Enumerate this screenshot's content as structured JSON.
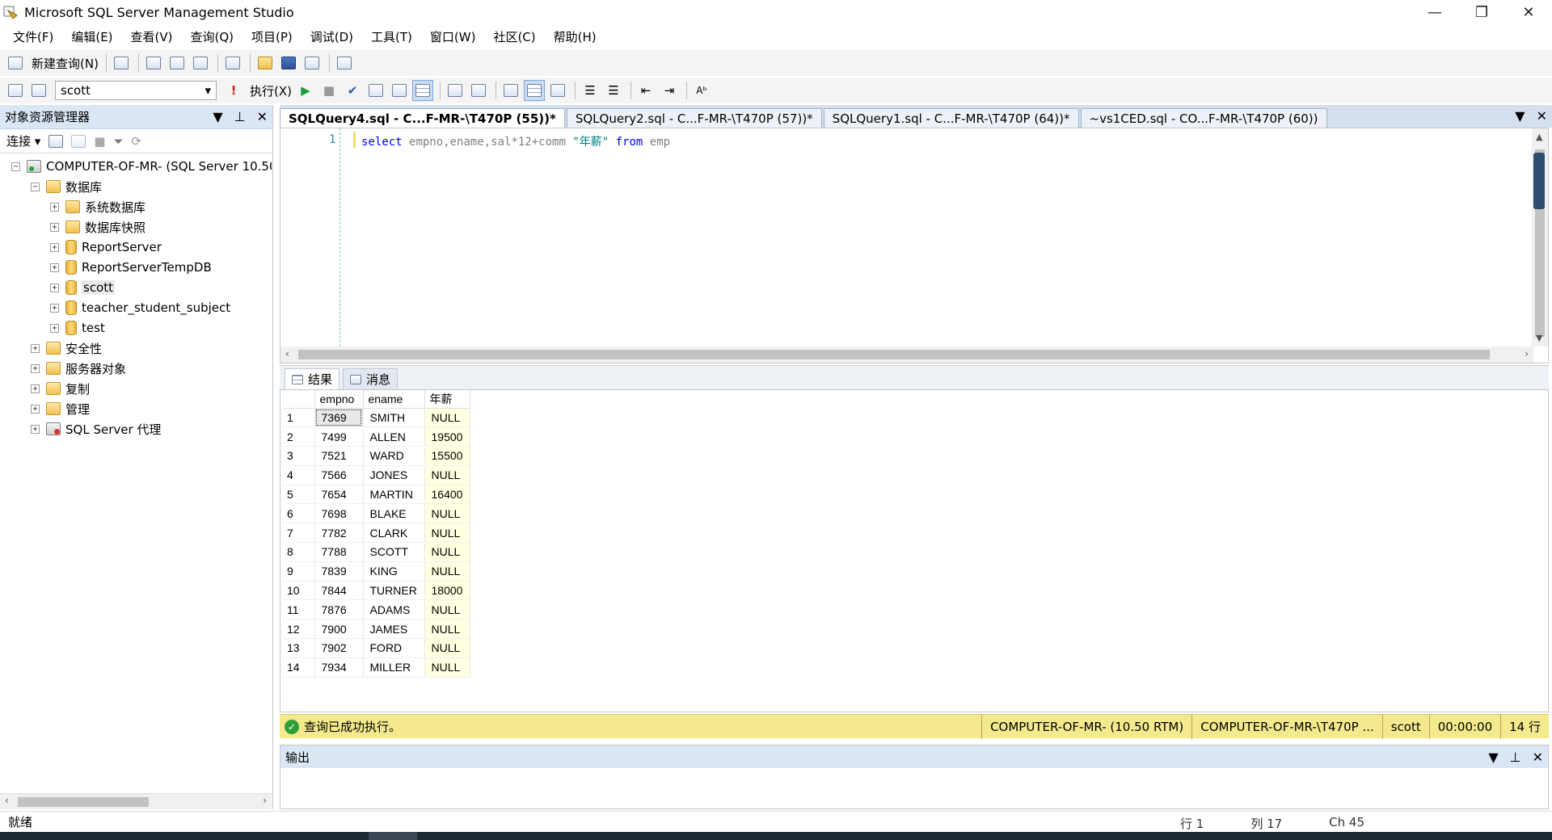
{
  "window": {
    "title": "Microsoft SQL Server Management Studio",
    "controls": [
      "—",
      "❐",
      "✕"
    ]
  },
  "menu": [
    "文件(F)",
    "编辑(E)",
    "查看(V)",
    "查询(Q)",
    "项目(P)",
    "调试(D)",
    "工具(T)",
    "窗口(W)",
    "社区(C)",
    "帮助(H)"
  ],
  "toolbar": {
    "new_query": "新建查询(N)",
    "database": "scott",
    "execute": "执行(X)"
  },
  "object_explorer": {
    "title": "对象资源管理器",
    "connect": "连接",
    "nodes": [
      {
        "label": "COMPUTER-OF-MR- (SQL Server 10.50",
        "level": 0,
        "expander": "−",
        "icon": "server"
      },
      {
        "label": "数据库",
        "level": 1,
        "expander": "−",
        "icon": "folder"
      },
      {
        "label": "系统数据库",
        "level": 2,
        "expander": "+",
        "icon": "folder"
      },
      {
        "label": "数据库快照",
        "level": 2,
        "expander": "+",
        "icon": "folder"
      },
      {
        "label": "ReportServer",
        "level": 2,
        "expander": "+",
        "icon": "db"
      },
      {
        "label": "ReportServerTempDB",
        "level": 2,
        "expander": "+",
        "icon": "db"
      },
      {
        "label": "scott",
        "level": 2,
        "expander": "+",
        "icon": "db",
        "selected": true
      },
      {
        "label": "teacher_student_subject",
        "level": 2,
        "expander": "+",
        "icon": "db"
      },
      {
        "label": "test",
        "level": 2,
        "expander": "+",
        "icon": "db"
      },
      {
        "label": "安全性",
        "level": 1,
        "expander": "+",
        "icon": "folder"
      },
      {
        "label": "服务器对象",
        "level": 1,
        "expander": "+",
        "icon": "folder"
      },
      {
        "label": "复制",
        "level": 1,
        "expander": "+",
        "icon": "folder"
      },
      {
        "label": "管理",
        "level": 1,
        "expander": "+",
        "icon": "folder"
      },
      {
        "label": "SQL Server 代理",
        "level": 1,
        "expander": "+",
        "icon": "agent"
      }
    ]
  },
  "tabs": [
    {
      "label": "SQLQuery4.sql - C...F-MR-\\T470P (55))*",
      "active": true
    },
    {
      "label": "SQLQuery2.sql - C...F-MR-\\T470P (57))*",
      "active": false
    },
    {
      "label": "SQLQuery1.sql - C...F-MR-\\T470P (64))*",
      "active": false
    },
    {
      "label": "~vs1CED.sql - CO...F-MR-\\T470P (60))",
      "active": false
    }
  ],
  "editor": {
    "line_number": "1",
    "code": {
      "kw_select": "select",
      "columns": "empno,ename,sal*12+comm",
      "alias": "\"年薪\"",
      "kw_from": "from",
      "table": "emp"
    }
  },
  "results": {
    "tab_results": "结果",
    "tab_messages": "消息",
    "columns": [
      "empno",
      "ename",
      "年薪"
    ],
    "rows": [
      [
        "1",
        "7369",
        "SMITH",
        "NULL"
      ],
      [
        "2",
        "7499",
        "ALLEN",
        "19500"
      ],
      [
        "3",
        "7521",
        "WARD",
        "15500"
      ],
      [
        "4",
        "7566",
        "JONES",
        "NULL"
      ],
      [
        "5",
        "7654",
        "MARTIN",
        "16400"
      ],
      [
        "6",
        "7698",
        "BLAKE",
        "NULL"
      ],
      [
        "7",
        "7782",
        "CLARK",
        "NULL"
      ],
      [
        "8",
        "7788",
        "SCOTT",
        "NULL"
      ],
      [
        "9",
        "7839",
        "KING",
        "NULL"
      ],
      [
        "10",
        "7844",
        "TURNER",
        "18000"
      ],
      [
        "11",
        "7876",
        "ADAMS",
        "NULL"
      ],
      [
        "12",
        "7900",
        "JAMES",
        "NULL"
      ],
      [
        "13",
        "7902",
        "FORD",
        "NULL"
      ],
      [
        "14",
        "7934",
        "MILLER",
        "NULL"
      ]
    ]
  },
  "query_status": {
    "message": "查询已成功执行。",
    "server": "COMPUTER-OF-MR- (10.50 RTM)",
    "connection": "COMPUTER-OF-MR-\\T470P ...",
    "db": "scott",
    "elapsed": "00:00:00",
    "rows": "14 行"
  },
  "output": {
    "title": "输出"
  },
  "statusbar": {
    "ready": "就绪",
    "line": "行 1",
    "col": "列 17",
    "ch": "Ch 45"
  }
}
